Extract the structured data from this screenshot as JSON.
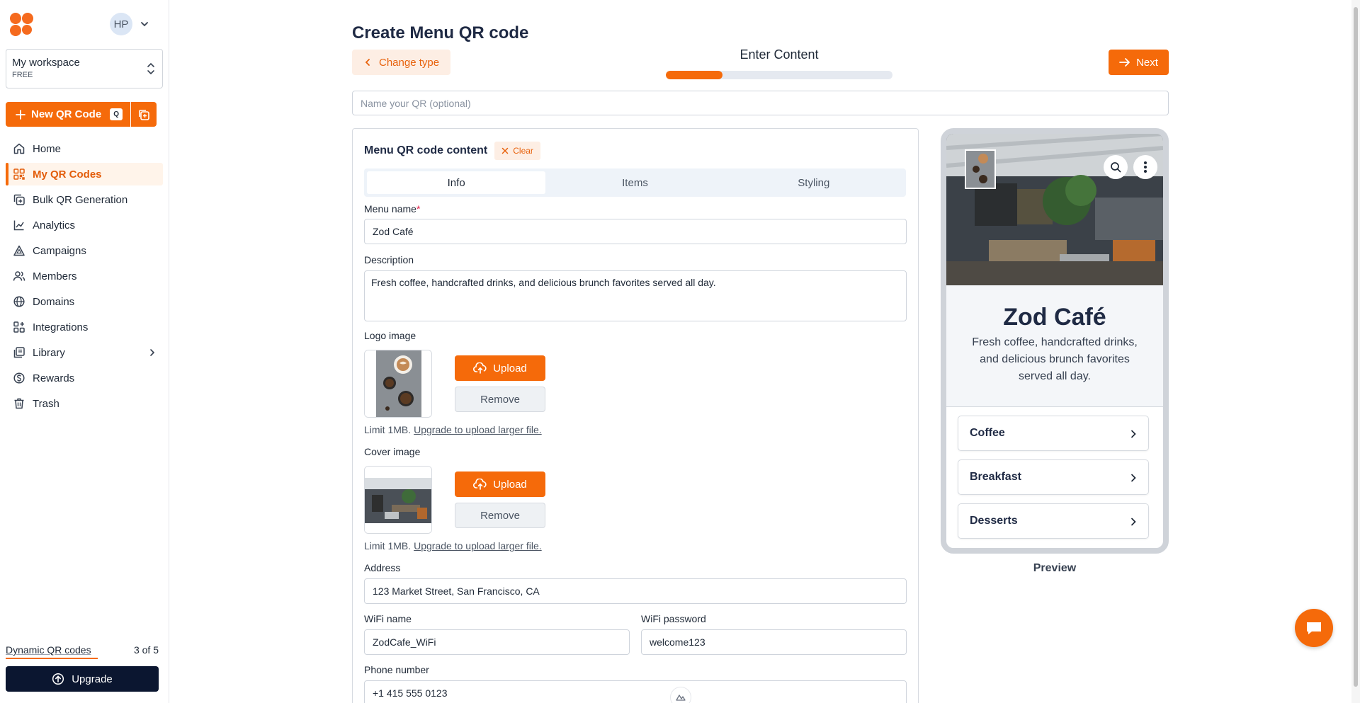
{
  "sidebar": {
    "avatar_initials": "HP",
    "workspace": {
      "name": "My workspace",
      "plan": "FREE"
    },
    "new_qr": {
      "label": "New QR Code",
      "shortcut": "Q"
    },
    "items": [
      {
        "label": "Home",
        "icon": "home-icon"
      },
      {
        "label": "My QR Codes",
        "icon": "qr-grid-icon",
        "active": true
      },
      {
        "label": "Bulk QR Generation",
        "icon": "bulk-copy-icon"
      },
      {
        "label": "Analytics",
        "icon": "chart-icon"
      },
      {
        "label": "Campaigns",
        "icon": "triangle-icon"
      },
      {
        "label": "Members",
        "icon": "users-icon"
      },
      {
        "label": "Domains",
        "icon": "globe-icon"
      },
      {
        "label": "Integrations",
        "icon": "integrations-icon"
      },
      {
        "label": "Library",
        "icon": "library-icon"
      },
      {
        "label": "Rewards",
        "icon": "dollar-icon"
      },
      {
        "label": "Trash",
        "icon": "trash-icon"
      }
    ],
    "dynamic": {
      "label": "Dynamic QR codes",
      "count": "3 of 5",
      "used": 3,
      "total": 5
    },
    "upgrade_label": "Upgrade"
  },
  "header": {
    "title": "Create Menu QR code",
    "change_type_label": "Change type",
    "step_label": "Enter Content",
    "progress": 0.25,
    "next_label": "Next",
    "name_placeholder": "Name your QR (optional)"
  },
  "form": {
    "title": "Menu QR code content",
    "clear_label": "Clear",
    "tabs": [
      "Info",
      "Items",
      "Styling"
    ],
    "active_tab": "Info",
    "menu_name_label": "Menu name",
    "required_mark": "*",
    "menu_name": "Zod Café",
    "description_label": "Description",
    "description": "Fresh coffee, handcrafted drinks, and delicious brunch favorites served all day.",
    "logo_label": "Logo image",
    "cover_label": "Cover image",
    "upload_label": "Upload",
    "remove_label": "Remove",
    "limit_text": "Limit 1MB.",
    "limit_link": "Upgrade to upload larger file.",
    "address_label": "Address",
    "address": "123 Market Street, San Francisco, CA",
    "wifi_name_label": "WiFi name",
    "wifi_name": "ZodCafe_WiFi",
    "wifi_password_label": "WiFi password",
    "wifi_password": "welcome123",
    "phone_label": "Phone number",
    "phone": "+1 415 555 0123"
  },
  "preview": {
    "title": "Zod Café",
    "description": "Fresh coffee, handcrafted drinks, and delicious brunch favorites served all day.",
    "categories": [
      "Coffee",
      "Breakfast",
      "Desserts"
    ],
    "label": "Preview"
  },
  "colors": {
    "accent": "#f56a0a",
    "accent_soft": "#fdeee4",
    "dark": "#0b1630"
  }
}
